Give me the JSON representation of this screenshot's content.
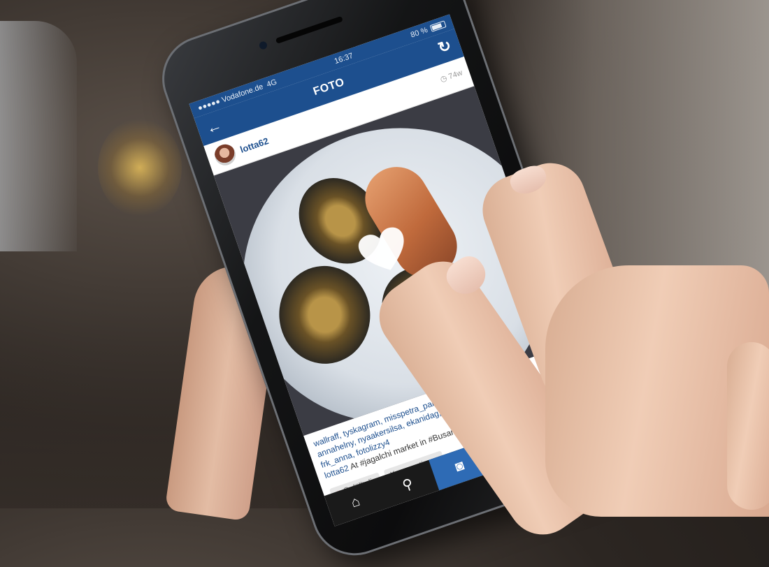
{
  "status_bar": {
    "carrier": "●●●●● Vodafone.de",
    "network": "4G",
    "time": "16:37",
    "battery": "80 %"
  },
  "nav": {
    "title": "FOTO",
    "back_icon": "arrow-left-icon",
    "refresh_icon": "refresh-icon"
  },
  "post": {
    "username": "lotta62",
    "time_ago": "◷ 74w",
    "likes_line1": "wallraff, tyskagram, misspetra_pan, eskim",
    "likes_line2": "annahelny, nyaakersilsa, ekanidag, ekholms",
    "likes_line3": "frk_anna, fotolizzy4",
    "caption_user": "lotta62",
    "caption_text": " At #jagalchi market in #Busan. #korea"
  },
  "actions": {
    "like_label": "Gefällt dir",
    "comment_label": "Kommentieren"
  },
  "tabbar": {
    "items": [
      "home-icon",
      "search-icon",
      "camera-icon",
      "heart-icon",
      "profile-icon"
    ],
    "active": "camera-icon"
  },
  "colors": {
    "accent": "#1d4f8e",
    "tab_active": "#2e6bb5",
    "tabbar_bg": "#1a1a1a"
  }
}
